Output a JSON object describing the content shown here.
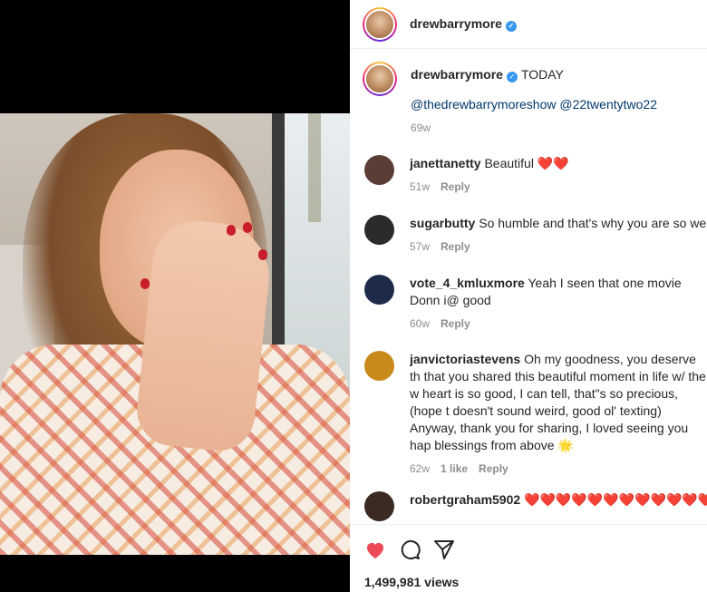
{
  "profile": {
    "username": "drewbarrymore",
    "verified": true,
    "avatar_icon": "profile-avatar"
  },
  "caption": {
    "username": "drewbarrymore",
    "time_label": "TODAY",
    "mentions": "@thedrewbarrymoreshow @22twentytwo22",
    "age": "69w"
  },
  "comments": [
    {
      "username": "janettanetty",
      "text": "Beautiful ❤️❤️",
      "age": "51w",
      "likes": "",
      "reply_label": "Reply",
      "avatar_color": "#5a3e36"
    },
    {
      "username": "sugarbutty",
      "text": "So humble and that's why you are so we",
      "age": "57w",
      "likes": "",
      "reply_label": "Reply",
      "avatar_color": "#2b2b2b"
    },
    {
      "username": "vote_4_kmluxmore",
      "text": "Yeah I seen that one movie Donn i@ good",
      "age": "60w",
      "likes": "",
      "reply_label": "Reply",
      "avatar_color": "#1f2b4a"
    },
    {
      "username": "janvictoriastevens",
      "text": "Oh my goodness, you deserve th that you shared this beautiful moment in life w/ the w heart is so good, I can tell, that\"s so precious, (hope t doesn't sound weird, good ol' texting) Anyway, thank you for sharing, I loved seeing you hap blessings from above 🌟",
      "age": "62w",
      "likes": "1 like",
      "reply_label": "Reply",
      "avatar_color": "#c98a1b"
    },
    {
      "username": "robertgraham5902",
      "text": "❤️❤️❤️❤️❤️❤️❤️❤️❤️❤️❤️❤️❤️❤️",
      "age": "",
      "likes": "",
      "reply_label": "",
      "avatar_color": "#3a2a22"
    }
  ],
  "actions": {
    "views": "1,499,981 views",
    "like_icon": "heart-icon",
    "comment_icon": "comment-icon",
    "share_icon": "share-icon",
    "liked_color": "#ed4956"
  }
}
